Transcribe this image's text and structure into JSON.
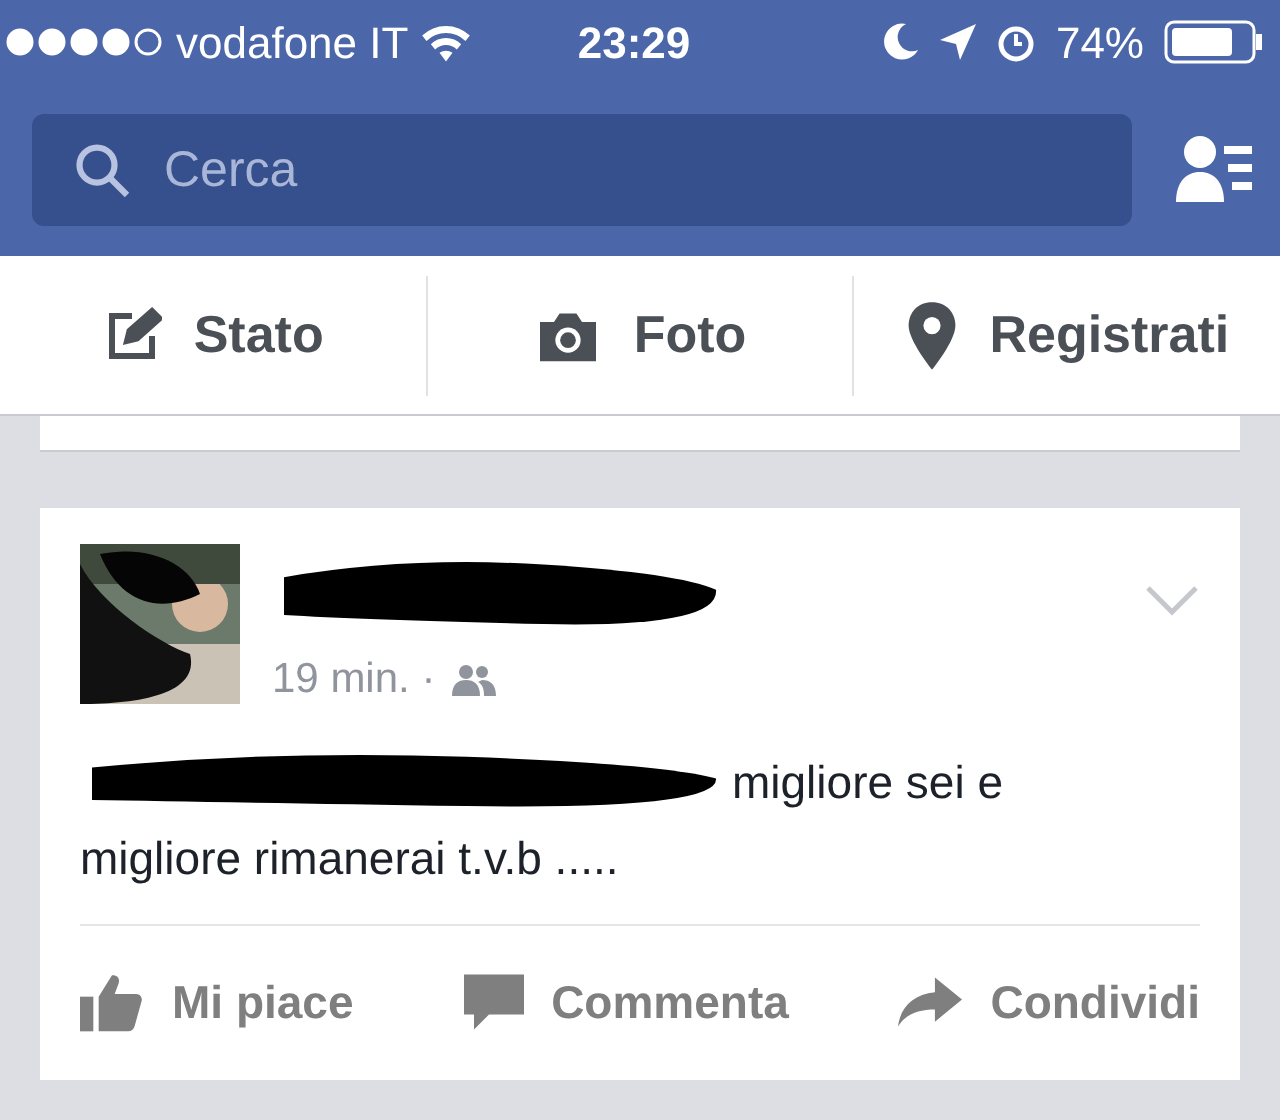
{
  "status_bar": {
    "carrier": "vodafone IT",
    "time": "23:29",
    "battery": "74%"
  },
  "search": {
    "placeholder": "Cerca"
  },
  "composer": [
    {
      "kind": "status",
      "label": "Stato"
    },
    {
      "label": "Foto"
    },
    {
      "kind": "checkin",
      "label": "Registrati"
    }
  ],
  "post": {
    "time": "19 min. ·",
    "text_lines": [
      "migliore sei e",
      "migliore rimanerai t.v.b ....."
    ],
    "actions": [
      {
        "kind": "like",
        "label": "Mi piace"
      },
      {
        "kind": "comment",
        "label": "Commenta"
      },
      {
        "kind": "share",
        "label": "Condividi"
      }
    ]
  }
}
